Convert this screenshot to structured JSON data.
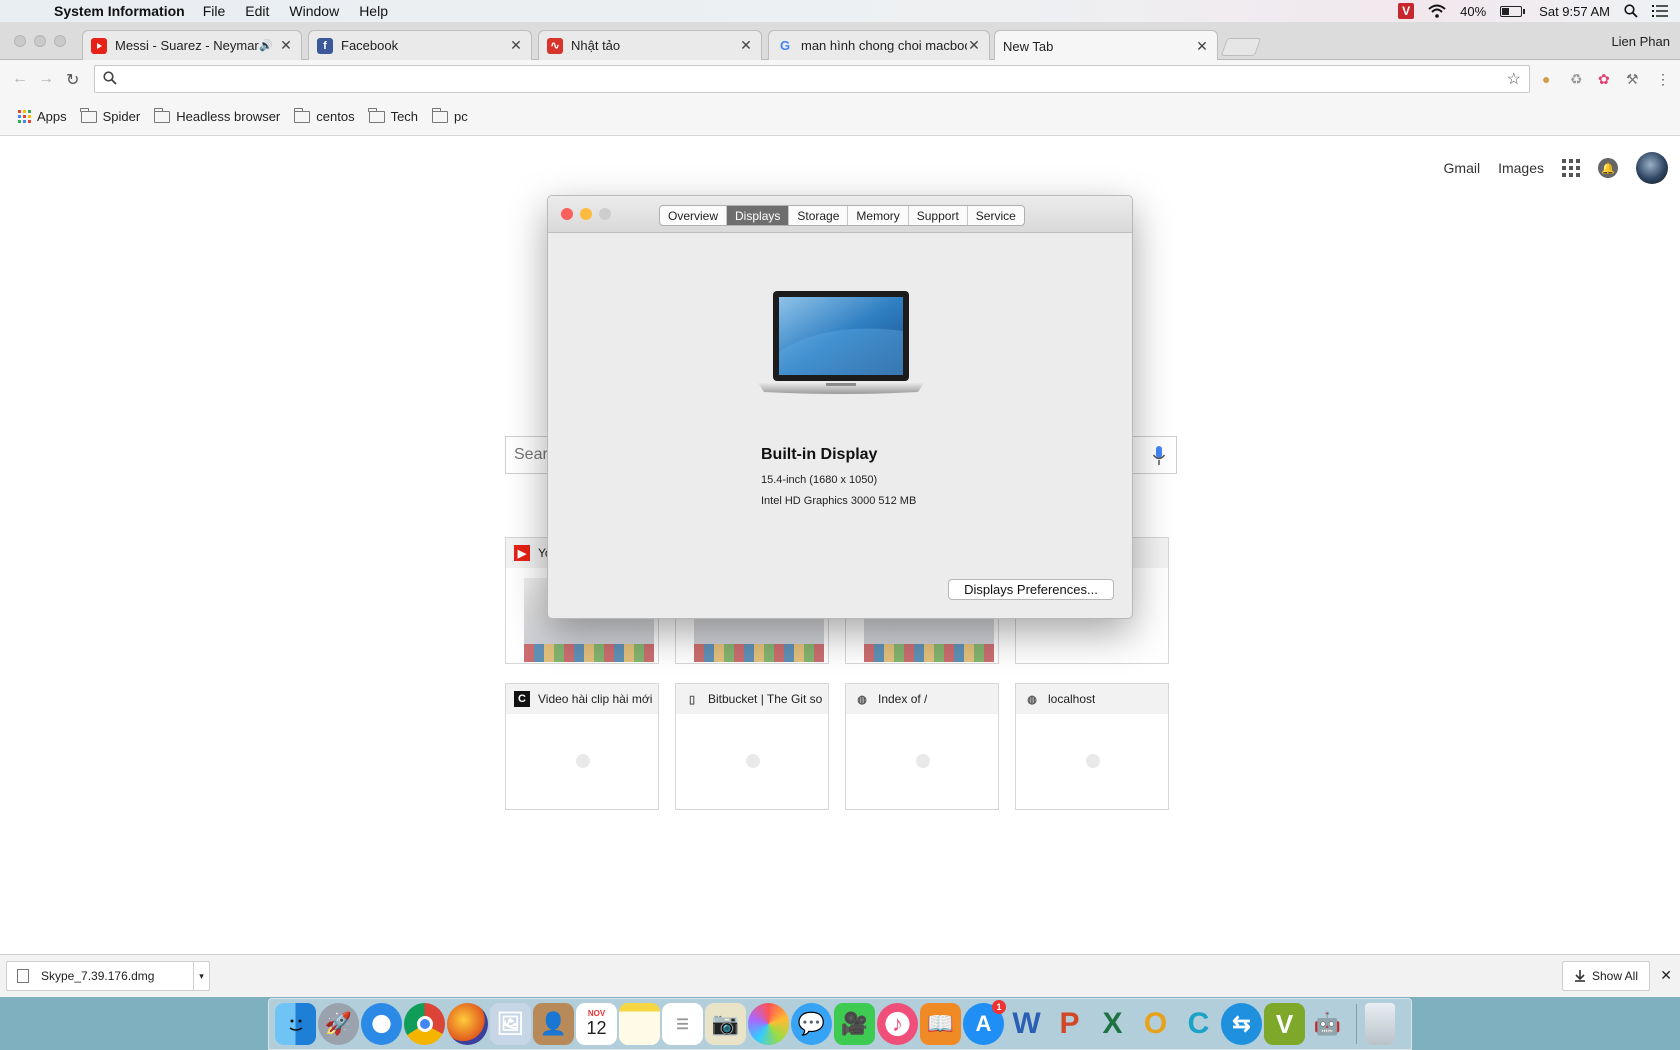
{
  "menubar": {
    "app_name": "System Information",
    "menus": [
      "File",
      "Edit",
      "Window",
      "Help"
    ],
    "battery_percent": "40%",
    "battery_level": 0.4,
    "clock": "Sat 9:57 AM",
    "vivaldi_badge": "V"
  },
  "browser": {
    "profile_name": "Lien Phan",
    "tabs": [
      {
        "title": "Messi - Suarez - Neymar bỏ",
        "favicon": "youtube-icon",
        "audio": "🔊",
        "close": "✕"
      },
      {
        "title": "Facebook",
        "favicon": "facebook-icon",
        "favicon_text": "f",
        "close": "✕"
      },
      {
        "title": "Nhật tảo",
        "favicon": "nhattao-icon",
        "favicon_text": "∿",
        "close": "✕"
      },
      {
        "title": "man hình chong choi macbook",
        "favicon": "google-icon",
        "favicon_text": "G",
        "close": "✕"
      },
      {
        "title": "New Tab",
        "favicon": "",
        "close": "✕"
      }
    ],
    "omnibox": {
      "value": "",
      "placeholder": ""
    },
    "bookmarks": [
      {
        "label": "Apps"
      },
      {
        "label": "Spider"
      },
      {
        "label": "Headless browser"
      },
      {
        "label": "centos"
      },
      {
        "label": "Tech"
      },
      {
        "label": "pc"
      }
    ]
  },
  "newtab": {
    "links": {
      "gmail": "Gmail",
      "images": "Images"
    },
    "search_placeholder": "Sear",
    "tiles_top": [
      {
        "title": "Yo",
        "icon": "youtube-icon"
      },
      {
        "title": "",
        "icon": ""
      },
      {
        "title": "",
        "icon": ""
      },
      {
        "title": "",
        "icon": ""
      }
    ],
    "tiles_bottom": [
      {
        "title": "Video hài clip hài mới",
        "icon_text": "C"
      },
      {
        "title": "Bitbucket | The Git so",
        "icon_text": "▯"
      },
      {
        "title": "Index of /",
        "icon_text": "◍"
      },
      {
        "title": "localhost",
        "icon_text": "◍"
      }
    ]
  },
  "downloads": {
    "file_name": "Skype_7.39.176.dmg",
    "arrow": "▾",
    "show_all": "Show All",
    "close": "✕"
  },
  "dialog": {
    "tabs": [
      "Overview",
      "Displays",
      "Storage",
      "Memory",
      "Support",
      "Service"
    ],
    "selected_tab": "Displays",
    "display_name": "Built-in Display",
    "size_line": "15.4-inch (1680 x 1050)",
    "graphics_line": "Intel HD Graphics 3000 512 MB",
    "prefs_button": "Displays Preferences..."
  },
  "dock": {
    "calendar_month": "NOV",
    "calendar_day": "12",
    "appstore_badge": "1",
    "letters": {
      "word": "W",
      "powerpoint": "P",
      "excel": "X",
      "outlook": "O",
      "ccleaner": "C",
      "vivaldi": "V"
    }
  },
  "colors": {
    "close_red": "#fc605c",
    "minimize_yellow": "#fdbc40",
    "zoom_gray": "#cdcdcd",
    "selected_segment": "#6e6e6e"
  }
}
